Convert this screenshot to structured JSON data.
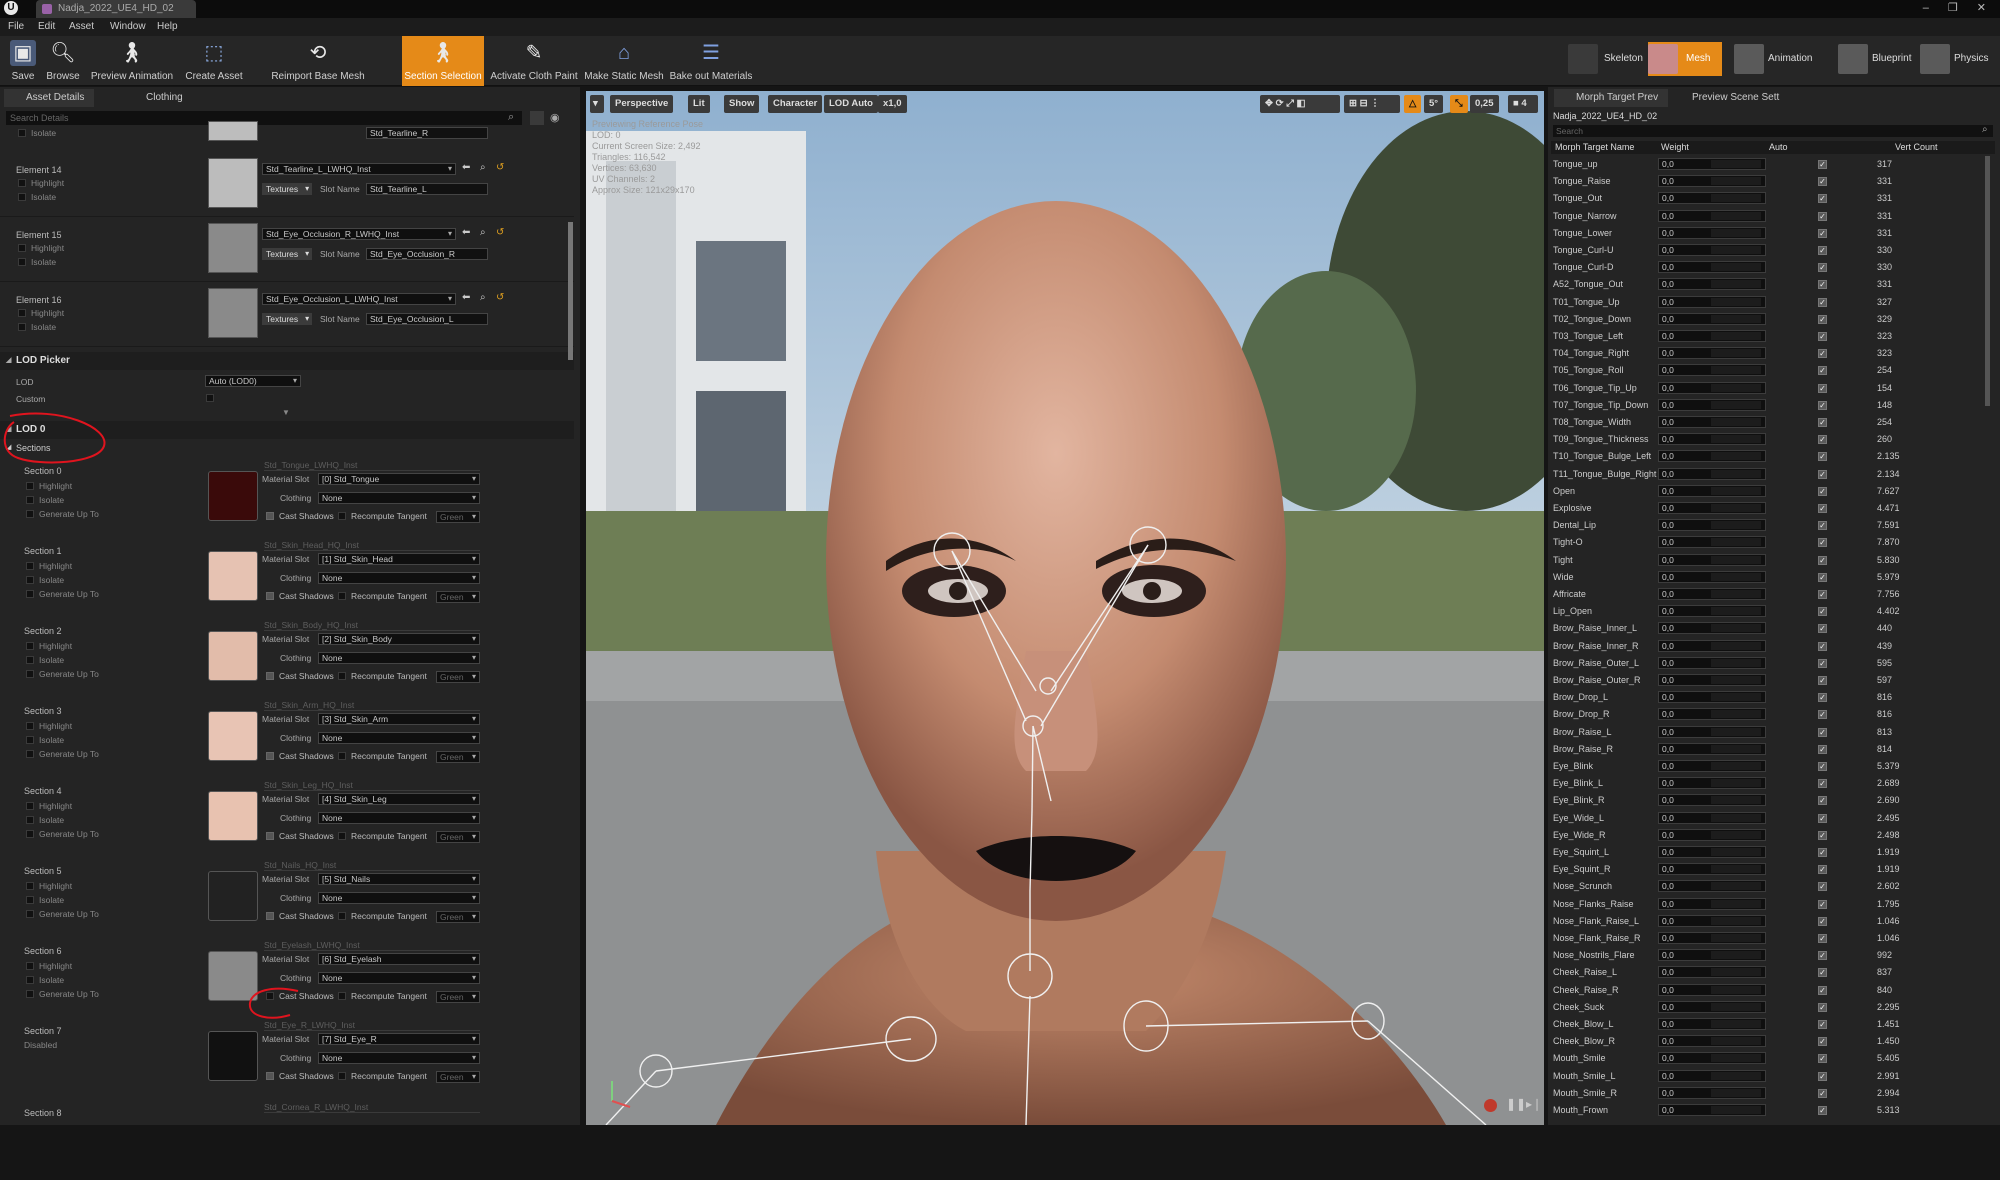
{
  "window": {
    "tab_title": "Nadja_2022_UE4_HD_02",
    "controls": "– ❐ ✕"
  },
  "menu": [
    "File",
    "Edit",
    "Asset",
    "Window",
    "Help"
  ],
  "toolbar": {
    "buttons": [
      "Save",
      "Browse",
      "Preview Animation",
      "Create Asset",
      "Reimport Base Mesh",
      "Section Selection",
      "Activate Cloth Paint",
      "Make Static Mesh",
      "Bake out Materials"
    ],
    "active": "Section Selection"
  },
  "modes": [
    "Skeleton",
    "Mesh",
    "Animation",
    "Blueprint",
    "Physics"
  ],
  "left_panel": {
    "tabs": [
      "Asset Details",
      "Clothing"
    ],
    "search_placeholder": "Search Details",
    "partial_top": {
      "highlight": "Highlight",
      "isolate": "Isolate",
      "slot_value": "Std_Tearline_R"
    },
    "elements": [
      {
        "name": "Element 14",
        "material": "Std_Tearline_L_LWHQ_Inst",
        "slot": "Std_Tearline_L"
      },
      {
        "name": "Element 15",
        "material": "Std_Eye_Occlusion_R_LWHQ_Inst",
        "slot": "Std_Eye_Occlusion_R"
      },
      {
        "name": "Element 16",
        "material": "Std_Eye_Occlusion_L_LWHQ_Inst",
        "slot": "Std_Eye_Occlusion_L"
      }
    ],
    "labels": {
      "highlight": "Highlight",
      "isolate": "Isolate",
      "textures": "Textures",
      "slot_name": "Slot Name",
      "material_slot": "Material Slot",
      "clothing": "Clothing",
      "cast_shadows": "Cast Shadows",
      "recompute_tangent": "Recompute Tangent",
      "green": "Green",
      "generate_up_to": "Generate Up To",
      "none": "None"
    },
    "lod_picker": {
      "title": "LOD Picker",
      "lod_label": "LOD",
      "lod_value": "Auto (LOD0)",
      "custom_label": "Custom"
    },
    "lod0": {
      "title": "LOD 0",
      "sections_title": "Sections"
    },
    "sections": [
      {
        "name": "Section 0",
        "mat": "Std_Tongue_LWHQ_Inst",
        "slot": "[0] Std_Tongue",
        "cast": true
      },
      {
        "name": "Section 1",
        "mat": "Std_Skin_Head_HQ_Inst",
        "slot": "[1] Std_Skin_Head",
        "cast": true
      },
      {
        "name": "Section 2",
        "mat": "Std_Skin_Body_HQ_Inst",
        "slot": "[2] Std_Skin_Body",
        "cast": true
      },
      {
        "name": "Section 3",
        "mat": "Std_Skin_Arm_HQ_Inst",
        "slot": "[3] Std_Skin_Arm",
        "cast": true
      },
      {
        "name": "Section 4",
        "mat": "Std_Skin_Leg_HQ_Inst",
        "slot": "[4] Std_Skin_Leg",
        "cast": true
      },
      {
        "name": "Section 5",
        "mat": "Std_Nails_HQ_Inst",
        "slot": "[5] Std_Nails",
        "cast": true
      },
      {
        "name": "Section 6",
        "mat": "Std_Eyelash_LWHQ_Inst",
        "slot": "[6] Std_Eyelash",
        "cast": false
      },
      {
        "name": "Section 7",
        "mat": "Std_Eye_R_LWHQ_Inst",
        "slot": "[7] Std_Eye_R",
        "cast": true,
        "disabled": "Disabled"
      },
      {
        "name": "Section 8",
        "mat": "Std_Cornea_R_LWHQ_Inst"
      }
    ]
  },
  "viewport": {
    "buttons": [
      "Perspective",
      "Lit",
      "Show",
      "Character",
      "LOD Auto",
      "x1,0"
    ],
    "info": [
      "Previewing Reference Pose",
      "LOD: 0",
      "Current Screen Size: 2,492",
      "Triangles: 116,542",
      "Vertices: 63,630",
      "UV Channels: 2",
      "Approx Size: 121x29x170"
    ],
    "right_controls": [
      "5°",
      "0,25",
      "4"
    ]
  },
  "right_panel": {
    "tabs": [
      "Morph Target Prev",
      "Preview Scene Sett"
    ],
    "asset": "Nadja_2022_UE4_HD_02",
    "search_placeholder": "Search",
    "headers": [
      "Morph Target Name",
      "Weight",
      "Auto",
      "Vert Count"
    ],
    "morphs": [
      [
        "Tongue_up",
        "317"
      ],
      [
        "Tongue_Raise",
        "331"
      ],
      [
        "Tongue_Out",
        "331"
      ],
      [
        "Tongue_Narrow",
        "331"
      ],
      [
        "Tongue_Lower",
        "331"
      ],
      [
        "Tongue_Curl-U",
        "330"
      ],
      [
        "Tongue_Curl-D",
        "330"
      ],
      [
        "A52_Tongue_Out",
        "331"
      ],
      [
        "T01_Tongue_Up",
        "327"
      ],
      [
        "T02_Tongue_Down",
        "329"
      ],
      [
        "T03_Tongue_Left",
        "323"
      ],
      [
        "T04_Tongue_Right",
        "323"
      ],
      [
        "T05_Tongue_Roll",
        "254"
      ],
      [
        "T06_Tongue_Tip_Up",
        "154"
      ],
      [
        "T07_Tongue_Tip_Down",
        "148"
      ],
      [
        "T08_Tongue_Width",
        "254"
      ],
      [
        "T09_Tongue_Thickness",
        "260"
      ],
      [
        "T10_Tongue_Bulge_Left",
        "2.135"
      ],
      [
        "T11_Tongue_Bulge_Right",
        "2.134"
      ],
      [
        "Open",
        "7.627"
      ],
      [
        "Explosive",
        "4.471"
      ],
      [
        "Dental_Lip",
        "7.591"
      ],
      [
        "Tight-O",
        "7.870"
      ],
      [
        "Tight",
        "5.830"
      ],
      [
        "Wide",
        "5.979"
      ],
      [
        "Affricate",
        "7.756"
      ],
      [
        "Lip_Open",
        "4.402"
      ],
      [
        "Brow_Raise_Inner_L",
        "440"
      ],
      [
        "Brow_Raise_Inner_R",
        "439"
      ],
      [
        "Brow_Raise_Outer_L",
        "595"
      ],
      [
        "Brow_Raise_Outer_R",
        "597"
      ],
      [
        "Brow_Drop_L",
        "816"
      ],
      [
        "Brow_Drop_R",
        "816"
      ],
      [
        "Brow_Raise_L",
        "813"
      ],
      [
        "Brow_Raise_R",
        "814"
      ],
      [
        "Eye_Blink",
        "5.379"
      ],
      [
        "Eye_Blink_L",
        "2.689"
      ],
      [
        "Eye_Blink_R",
        "2.690"
      ],
      [
        "Eye_Wide_L",
        "2.495"
      ],
      [
        "Eye_Wide_R",
        "2.498"
      ],
      [
        "Eye_Squint_L",
        "1.919"
      ],
      [
        "Eye_Squint_R",
        "1.919"
      ],
      [
        "Nose_Scrunch",
        "2.602"
      ],
      [
        "Nose_Flanks_Raise",
        "1.795"
      ],
      [
        "Nose_Flank_Raise_L",
        "1.046"
      ],
      [
        "Nose_Flank_Raise_R",
        "1.046"
      ],
      [
        "Nose_Nostrils_Flare",
        "992"
      ],
      [
        "Cheek_Raise_L",
        "837"
      ],
      [
        "Cheek_Raise_R",
        "840"
      ],
      [
        "Cheek_Suck",
        "2.295"
      ],
      [
        "Cheek_Blow_L",
        "1.451"
      ],
      [
        "Cheek_Blow_R",
        "1.450"
      ],
      [
        "Mouth_Smile",
        "5.405"
      ],
      [
        "Mouth_Smile_L",
        "2.991"
      ],
      [
        "Mouth_Smile_R",
        "2.994"
      ],
      [
        "Mouth_Frown",
        "5.313"
      ]
    ],
    "weight": "0,0",
    "check": "✓"
  },
  "colors": {
    "accent": "#e58a18",
    "annotation": "#e0141e"
  }
}
